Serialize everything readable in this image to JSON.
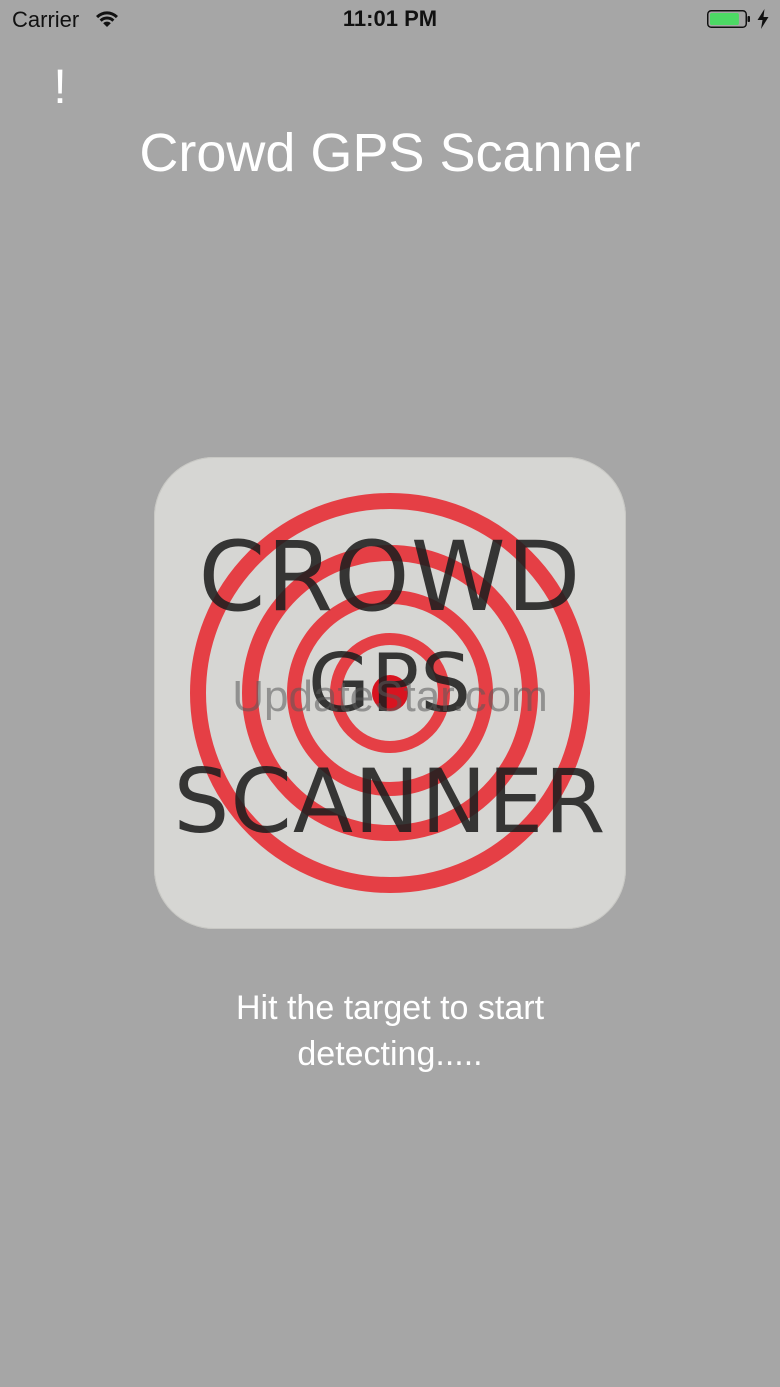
{
  "status_bar": {
    "carrier": "Carrier",
    "time": "11:01 PM",
    "battery_level": 0.85,
    "battery_color": "#4cd964",
    "icons": [
      "wifi-icon",
      "battery-icon",
      "charging-bolt-icon"
    ]
  },
  "header": {
    "alert_label": "!",
    "title": "Crowd GPS Scanner"
  },
  "target": {
    "logo_line1": "CROWD",
    "logo_line2": "GPS",
    "logo_line3": "SCANNER",
    "watermark": "UpdateStar.com",
    "ring_color": "#e8242c",
    "icon": "target-icon"
  },
  "instruction": "Hit the target to start detecting.....",
  "colors": {
    "background": "#a6a6a6",
    "text": "#ffffff",
    "icon_background": "#d6d6d3"
  }
}
